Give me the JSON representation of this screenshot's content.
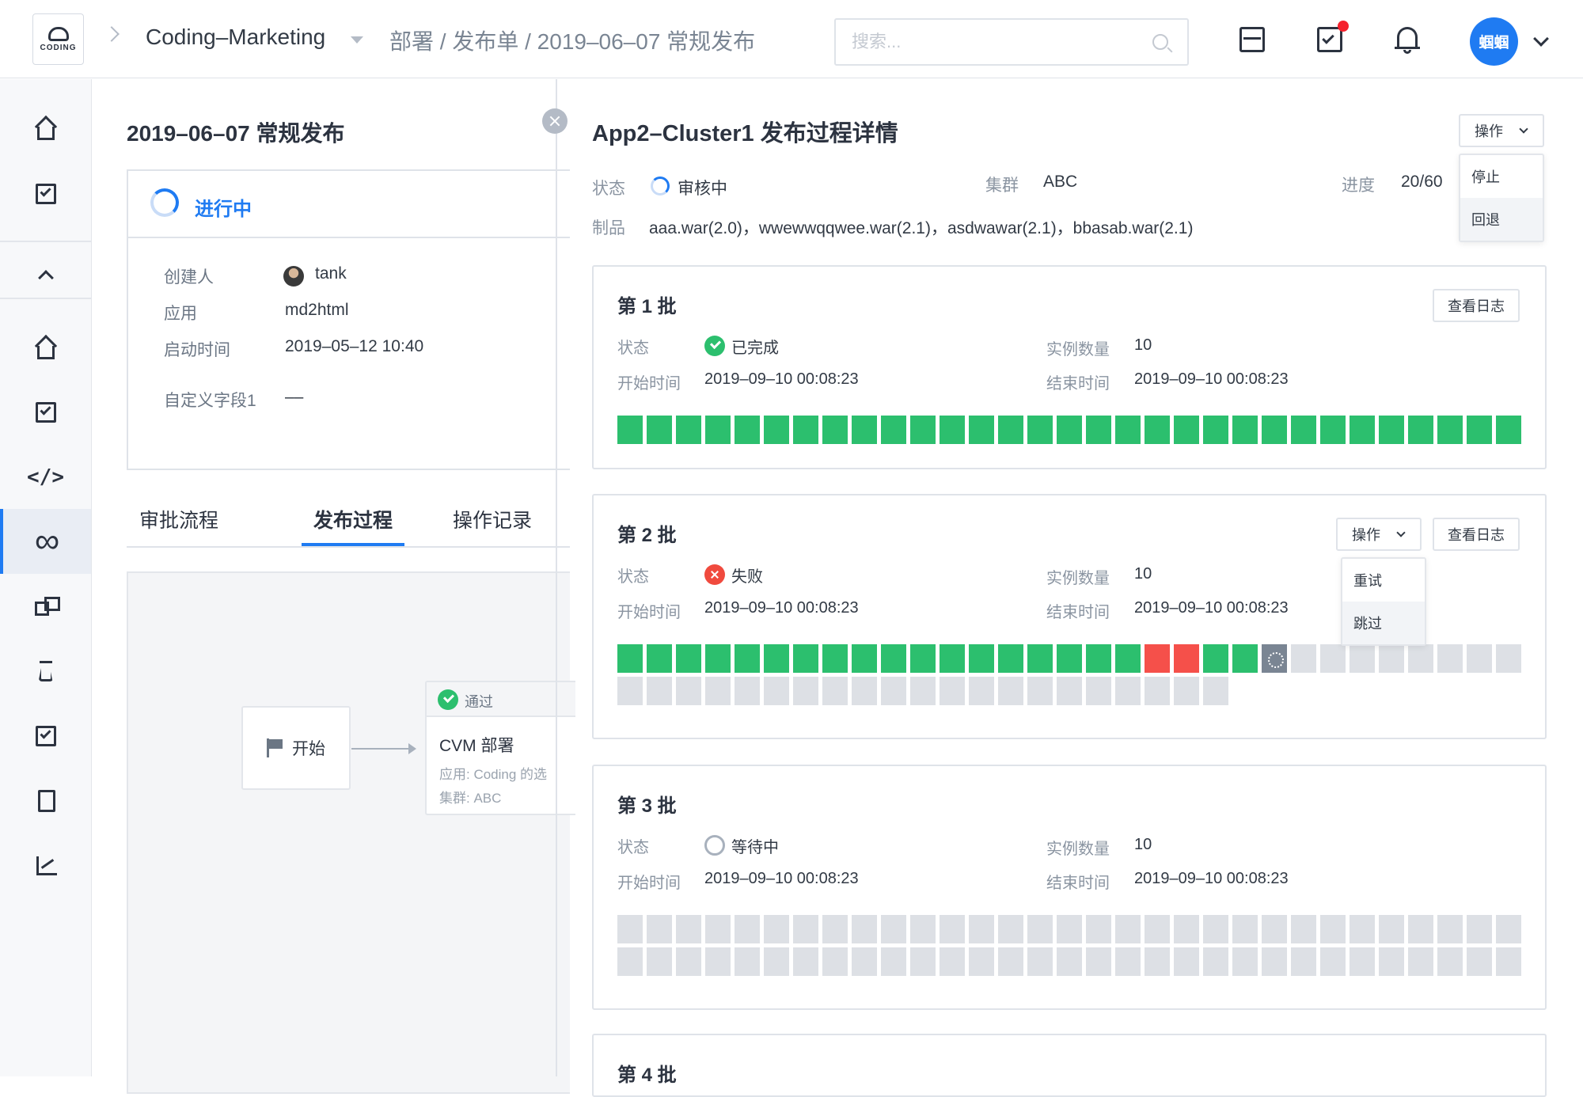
{
  "topbar": {
    "logo_text": "CODING",
    "project": "Coding–Marketing",
    "breadcrumb": "部署 / 发布单 / 2019–06–07 常规发布",
    "search_placeholder": "搜索...",
    "user": "蝈蝈"
  },
  "left": {
    "title": "2019–06–07 常规发布",
    "status": "进行中",
    "fields": [
      {
        "label": "创建人",
        "value": "tank"
      },
      {
        "label": "应用",
        "value": "md2html"
      },
      {
        "label": "启动时间",
        "value": "2019–05–12 10:40"
      },
      {
        "label": "自定义字段1",
        "value": "––"
      }
    ],
    "tabs": [
      "审批流程",
      "发布过程",
      "操作记录"
    ],
    "active_tab": "发布过程",
    "flow": {
      "start_label": "开始",
      "node_pass": "通过",
      "node_title": "CVM 部署",
      "node_app": "应用: Coding 的选",
      "node_cluster": "集群: ABC"
    }
  },
  "right": {
    "title": "App2–Cluster1 发布过程详情",
    "op_label": "操作",
    "op_menu": [
      "停止",
      "回退"
    ],
    "status_label": "状态",
    "status_value": "审核中",
    "cluster_label": "集群",
    "cluster_value": "ABC",
    "progress_label": "进度",
    "progress_value": "20/60",
    "product_label": "制品",
    "product_value": "aaa.war(2.0)，wwewwqqwee.war(2.1)，asdwawar(2.1)，bbasab.war(2.1)"
  },
  "batches": [
    {
      "title": "第 1 批",
      "status": "已完成",
      "status_type": "done",
      "instances": "10",
      "start": "2019–09–10 00:08:23",
      "end": "2019–09–10 00:08:23",
      "log_label": "查看日志"
    },
    {
      "title": "第 2 批",
      "status": "失败",
      "status_type": "fail",
      "instances": "10",
      "start": "2019–09–10 00:08:23",
      "end": "2019–09–10 00:08:23",
      "log_label": "查看日志",
      "op_label": "操作",
      "op_menu": [
        "重试",
        "跳过"
      ]
    },
    {
      "title": "第 3 批",
      "status": "等待中",
      "status_type": "wait",
      "instances": "10",
      "start": "2019–09–10 00:08:23",
      "end": "2019–09–10 00:08:23"
    },
    {
      "title": "第 4 批"
    }
  ],
  "batch_labels": {
    "status": "状态",
    "instances": "实例数量",
    "start": "开始时间",
    "end": "结束时间"
  },
  "grids": {
    "batch1": {
      "green": 31
    },
    "batch2": {
      "sequence": [
        "g",
        "g",
        "g",
        "g",
        "g",
        "g",
        "g",
        "g",
        "g",
        "g",
        "g",
        "g",
        "g",
        "g",
        "g",
        "g",
        "g",
        "g",
        "r",
        "r",
        "g",
        "g",
        "run",
        "x",
        "x",
        "x",
        "x",
        "x",
        "x",
        "x",
        "x",
        "x",
        "x",
        "x",
        "x",
        "x",
        "x",
        "x",
        "x",
        "x",
        "x",
        "x",
        "x",
        "x",
        "x",
        "x",
        "x",
        "x",
        "x",
        "x",
        "x",
        "x"
      ]
    },
    "batch3": {
      "gray": 62
    }
  },
  "colors": {
    "primary": "#1f7bf2",
    "success": "#2cbf6e",
    "danger": "#f5504a",
    "pending": "#dde0e5"
  }
}
